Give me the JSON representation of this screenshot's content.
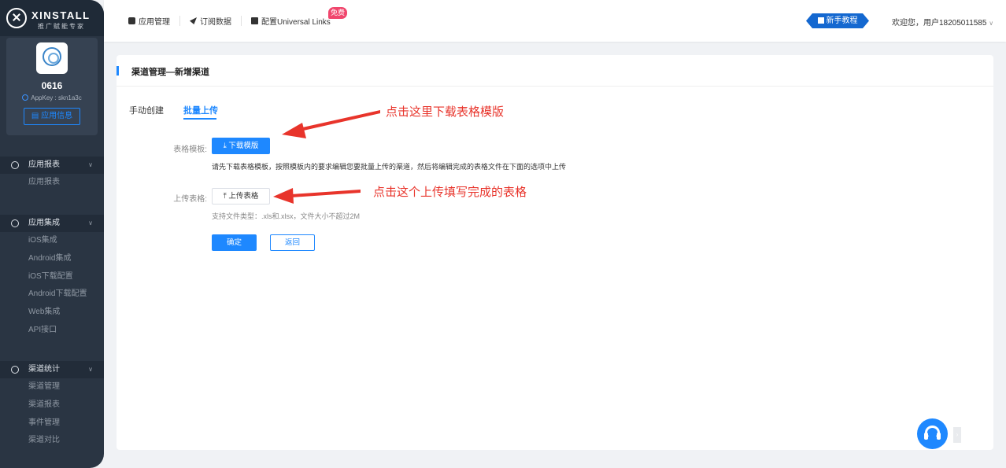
{
  "brand": {
    "name": "XINSTALL",
    "subtitle": "推广赋能专家"
  },
  "app": {
    "name": "0616",
    "appkey": "AppKey : skn1a3c",
    "info_button": "应用信息"
  },
  "sidebar": {
    "groups": [
      {
        "title": "应用报表",
        "icon": "clock-icon",
        "items": [
          "应用报表"
        ]
      },
      {
        "title": "应用集成",
        "icon": "cube-icon",
        "items": [
          "iOS集成",
          "Android集成",
          "iOS下载配置",
          "Android下载配置",
          "Web集成",
          "API接口"
        ]
      },
      {
        "title": "渠道统计",
        "icon": "triangle-icon",
        "items": [
          "渠道管理",
          "渠道报表",
          "事件管理",
          "渠道对比"
        ]
      }
    ]
  },
  "topbar": {
    "nav": [
      "应用管理",
      "订阅数据",
      "配置Universal Links"
    ],
    "free_badge": "免费",
    "guide_button": "新手教程",
    "welcome": "欢迎您，用户18205011585"
  },
  "page": {
    "title": "渠道管理—新增渠道",
    "tabs": [
      "手动创建",
      "批量上传"
    ],
    "active_tab": "批量上传",
    "template_label": "表格模板:",
    "download_button": "下载模版",
    "template_hint": "请先下载表格模板，按照模板内的要求编辑您要批量上传的渠道，然后将编辑完成的表格文件在下面的选项中上传",
    "upload_label": "上传表格:",
    "upload_button": "上传表格",
    "upload_hint": "支持文件类型：.xls和.xlsx，文件大小不超过2M",
    "confirm_button": "确定",
    "back_button": "返回"
  },
  "annotations": {
    "download_note": "点击这里下载表格模版",
    "upload_note": "点击这个上传填写完成的表格",
    "color": "#e8342b"
  },
  "colors": {
    "accent": "#1e88ff",
    "sidebar": "#2a3543",
    "badge": "#f0466d"
  }
}
